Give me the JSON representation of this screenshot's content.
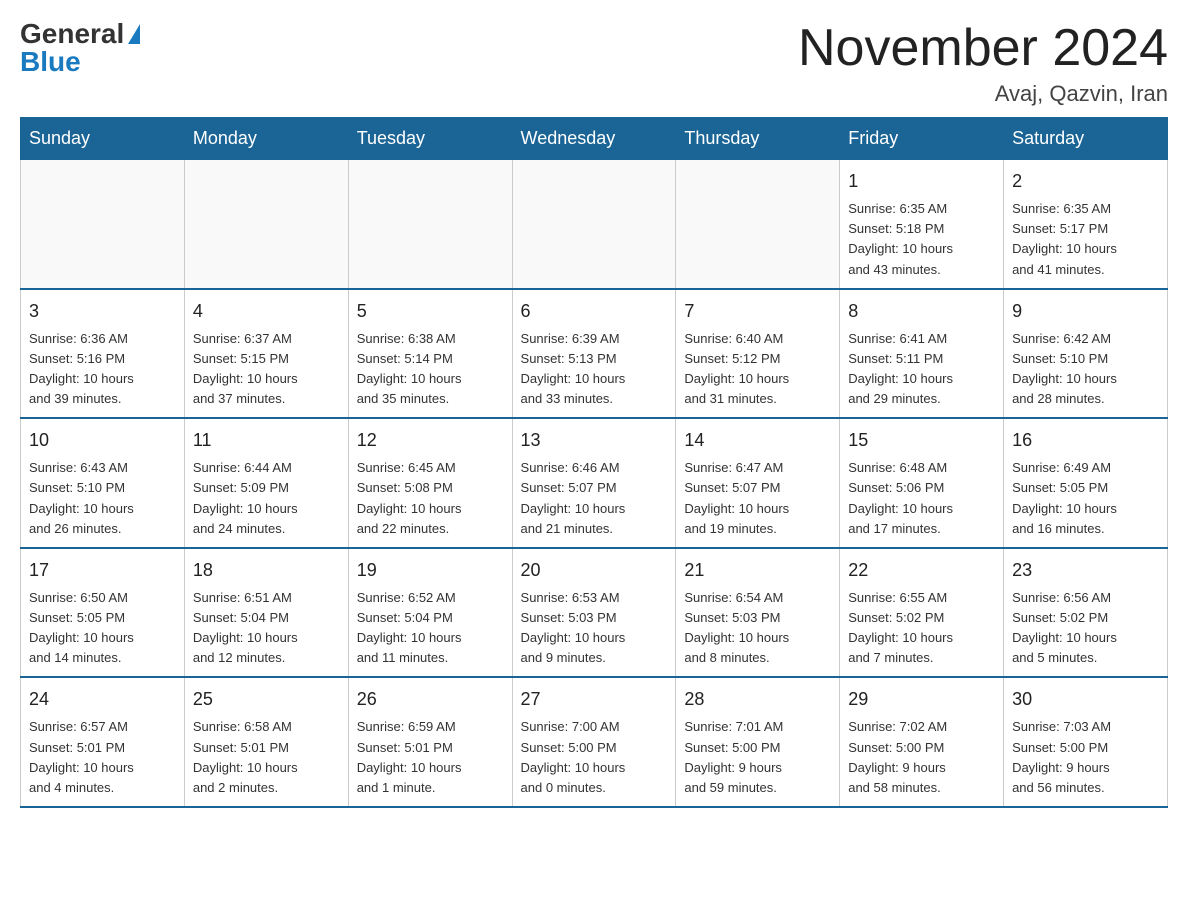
{
  "logo": {
    "general": "General",
    "blue": "Blue"
  },
  "title": "November 2024",
  "subtitle": "Avaj, Qazvin, Iran",
  "weekdays": [
    "Sunday",
    "Monday",
    "Tuesday",
    "Wednesday",
    "Thursday",
    "Friday",
    "Saturday"
  ],
  "rows": [
    [
      {
        "day": "",
        "info": ""
      },
      {
        "day": "",
        "info": ""
      },
      {
        "day": "",
        "info": ""
      },
      {
        "day": "",
        "info": ""
      },
      {
        "day": "",
        "info": ""
      },
      {
        "day": "1",
        "info": "Sunrise: 6:35 AM\nSunset: 5:18 PM\nDaylight: 10 hours\nand 43 minutes."
      },
      {
        "day": "2",
        "info": "Sunrise: 6:35 AM\nSunset: 5:17 PM\nDaylight: 10 hours\nand 41 minutes."
      }
    ],
    [
      {
        "day": "3",
        "info": "Sunrise: 6:36 AM\nSunset: 5:16 PM\nDaylight: 10 hours\nand 39 minutes."
      },
      {
        "day": "4",
        "info": "Sunrise: 6:37 AM\nSunset: 5:15 PM\nDaylight: 10 hours\nand 37 minutes."
      },
      {
        "day": "5",
        "info": "Sunrise: 6:38 AM\nSunset: 5:14 PM\nDaylight: 10 hours\nand 35 minutes."
      },
      {
        "day": "6",
        "info": "Sunrise: 6:39 AM\nSunset: 5:13 PM\nDaylight: 10 hours\nand 33 minutes."
      },
      {
        "day": "7",
        "info": "Sunrise: 6:40 AM\nSunset: 5:12 PM\nDaylight: 10 hours\nand 31 minutes."
      },
      {
        "day": "8",
        "info": "Sunrise: 6:41 AM\nSunset: 5:11 PM\nDaylight: 10 hours\nand 29 minutes."
      },
      {
        "day": "9",
        "info": "Sunrise: 6:42 AM\nSunset: 5:10 PM\nDaylight: 10 hours\nand 28 minutes."
      }
    ],
    [
      {
        "day": "10",
        "info": "Sunrise: 6:43 AM\nSunset: 5:10 PM\nDaylight: 10 hours\nand 26 minutes."
      },
      {
        "day": "11",
        "info": "Sunrise: 6:44 AM\nSunset: 5:09 PM\nDaylight: 10 hours\nand 24 minutes."
      },
      {
        "day": "12",
        "info": "Sunrise: 6:45 AM\nSunset: 5:08 PM\nDaylight: 10 hours\nand 22 minutes."
      },
      {
        "day": "13",
        "info": "Sunrise: 6:46 AM\nSunset: 5:07 PM\nDaylight: 10 hours\nand 21 minutes."
      },
      {
        "day": "14",
        "info": "Sunrise: 6:47 AM\nSunset: 5:07 PM\nDaylight: 10 hours\nand 19 minutes."
      },
      {
        "day": "15",
        "info": "Sunrise: 6:48 AM\nSunset: 5:06 PM\nDaylight: 10 hours\nand 17 minutes."
      },
      {
        "day": "16",
        "info": "Sunrise: 6:49 AM\nSunset: 5:05 PM\nDaylight: 10 hours\nand 16 minutes."
      }
    ],
    [
      {
        "day": "17",
        "info": "Sunrise: 6:50 AM\nSunset: 5:05 PM\nDaylight: 10 hours\nand 14 minutes."
      },
      {
        "day": "18",
        "info": "Sunrise: 6:51 AM\nSunset: 5:04 PM\nDaylight: 10 hours\nand 12 minutes."
      },
      {
        "day": "19",
        "info": "Sunrise: 6:52 AM\nSunset: 5:04 PM\nDaylight: 10 hours\nand 11 minutes."
      },
      {
        "day": "20",
        "info": "Sunrise: 6:53 AM\nSunset: 5:03 PM\nDaylight: 10 hours\nand 9 minutes."
      },
      {
        "day": "21",
        "info": "Sunrise: 6:54 AM\nSunset: 5:03 PM\nDaylight: 10 hours\nand 8 minutes."
      },
      {
        "day": "22",
        "info": "Sunrise: 6:55 AM\nSunset: 5:02 PM\nDaylight: 10 hours\nand 7 minutes."
      },
      {
        "day": "23",
        "info": "Sunrise: 6:56 AM\nSunset: 5:02 PM\nDaylight: 10 hours\nand 5 minutes."
      }
    ],
    [
      {
        "day": "24",
        "info": "Sunrise: 6:57 AM\nSunset: 5:01 PM\nDaylight: 10 hours\nand 4 minutes."
      },
      {
        "day": "25",
        "info": "Sunrise: 6:58 AM\nSunset: 5:01 PM\nDaylight: 10 hours\nand 2 minutes."
      },
      {
        "day": "26",
        "info": "Sunrise: 6:59 AM\nSunset: 5:01 PM\nDaylight: 10 hours\nand 1 minute."
      },
      {
        "day": "27",
        "info": "Sunrise: 7:00 AM\nSunset: 5:00 PM\nDaylight: 10 hours\nand 0 minutes."
      },
      {
        "day": "28",
        "info": "Sunrise: 7:01 AM\nSunset: 5:00 PM\nDaylight: 9 hours\nand 59 minutes."
      },
      {
        "day": "29",
        "info": "Sunrise: 7:02 AM\nSunset: 5:00 PM\nDaylight: 9 hours\nand 58 minutes."
      },
      {
        "day": "30",
        "info": "Sunrise: 7:03 AM\nSunset: 5:00 PM\nDaylight: 9 hours\nand 56 minutes."
      }
    ]
  ]
}
